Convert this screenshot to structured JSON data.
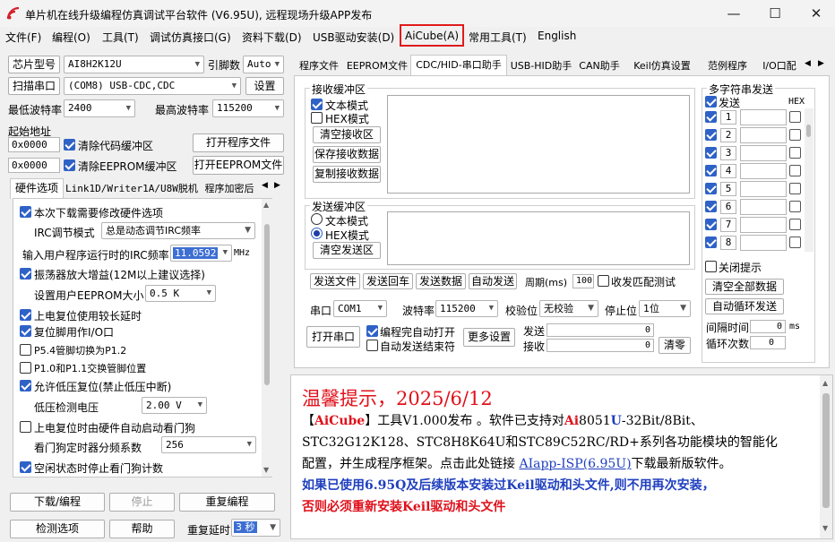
{
  "window": {
    "title": "单片机在线升级编程仿真调试平台软件 (V6.95U), 远程现场升级APP发布",
    "min": "—",
    "max": "☐",
    "close": "✕"
  },
  "menu": {
    "items": [
      "文件(F)",
      "编程(O)",
      "工具(T)",
      "调试仿真接口(G)",
      "资料下载(D)",
      "USB驱动安装(D)",
      "AiCube(A)",
      "常用工具(T)",
      "English"
    ]
  },
  "left": {
    "chip_button": "芯片型号",
    "chip_value": "AI8H2K12U",
    "pin_label": "引脚数",
    "pin_value": "Auto",
    "scan_button": "扫描串口",
    "port_value": "(COM8) USB-CDC,CDC",
    "settings_button": "设置",
    "min_baud_label": "最低波特率",
    "min_baud_value": "2400",
    "max_baud_label": "最高波特率",
    "max_baud_value": "115200",
    "start_addr_label": "起始地址",
    "addr1": "0x0000",
    "clear_code_label": "清除代码缓冲区",
    "open_prog_button": "打开程序文件",
    "addr2": "0x0000",
    "clear_eeprom_label": "清除EEPROM缓冲区",
    "open_eeprom_button": "打开EEPROM文件",
    "tabs": [
      "硬件选项",
      "Link1D/Writer1A/U8W脱机",
      "程序加密后"
    ],
    "hw": {
      "opt1": "本次下载需要修改硬件选项",
      "irc_mode_label": "IRC调节模式",
      "irc_mode_value": "总是动态调节IRC频率",
      "irc_freq_label": "输入用户程序运行时的IRC频率",
      "irc_freq_value": "11.0592",
      "irc_freq_unit": "MHz",
      "opt2": "振荡器放大增益(12M以上建议选择)",
      "eeprom_size_label": "设置用户EEPROM大小",
      "eeprom_size_value": "0.5 K",
      "opt3": "上电复位使用较长延时",
      "opt4": "复位脚用作I/O口",
      "opt5": "P5.4管脚切换为P1.2",
      "opt6": "P1.0和P1.1交换管脚位置",
      "opt7": "允许低压复位(禁止低压中断)",
      "lvd_label": "低压检测电压",
      "lvd_value": "2.00 V",
      "opt8": "上电复位时由硬件自动启动看门狗",
      "wdt_label": "看门狗定时器分频系数",
      "wdt_value": "256",
      "opt9": "空闲状态时停止看门狗计数"
    },
    "download_button": "下载/编程",
    "stop_button": "停止",
    "reprogram_button": "重复编程",
    "check_button": "检测选项",
    "help_button": "帮助",
    "repeat_delay_label": "重复延时",
    "repeat_delay_value": "3 秒"
  },
  "right": {
    "tabs": [
      "程序文件",
      "EEPROM文件",
      "CDC/HID-串口助手",
      "USB-HID助手",
      "CAN助手",
      "Keil仿真设置",
      "范例程序",
      "I/O口配"
    ],
    "recv": {
      "title": "接收缓冲区",
      "text_mode": "文本模式",
      "hex_mode": "HEX模式",
      "clear": "清空接收区",
      "save": "保存接收数据",
      "copy": "复制接收数据"
    },
    "send": {
      "title": "发送缓冲区",
      "text_mode": "文本模式",
      "hex_mode": "HEX模式",
      "clear": "清空发送区"
    },
    "send_file": "发送文件",
    "send_back": "发送回车",
    "send_data": "发送数据",
    "auto_send": "自动发送",
    "period_label": "周期(ms)",
    "period_value": "100",
    "match_label": "收发匹配测试",
    "port_label": "串口",
    "port_value": "COM1",
    "baud_label": "波特率",
    "baud_value": "115200",
    "parity_label": "校验位",
    "parity_value": "无校验",
    "stop_label": "停止位",
    "stop_value": "1位",
    "open_port": "打开串口",
    "auto_open": "编程完自动打开",
    "auto_close": "自动发送结束符",
    "more_settings": "更多设置",
    "sent_label": "发送",
    "sent_value": "0",
    "recv_label": "接收",
    "recv_value": "0",
    "zero_button": "清零",
    "multi": {
      "title": "多字符串发送",
      "send_label": "发送",
      "hex_label": "HEX",
      "rows": [
        "1",
        "2",
        "3",
        "4",
        "5",
        "6",
        "7",
        "8"
      ],
      "close_tip": "关闭提示",
      "clear_all": "清空全部数据",
      "auto_loop": "自动循环发送",
      "interval_label": "间隔时间",
      "interval_value": "0",
      "interval_unit": "ms",
      "loop_label": "循环次数",
      "loop_value": "0"
    }
  },
  "notice": {
    "heading": "温馨提示，2025/6/12",
    "l1_a": "【",
    "l1_b": "AiCube",
    "l1_c": "】工具V1.000发布 。软件已支持对",
    "l1_d": "Ai",
    "l1_e": "8051",
    "l1_f": "U",
    "l1_g": "-32Bit/8Bit、",
    "l2": "STC32G12K128、STC8H8K64U和STC89C52RC/RD+系列各功能模块的智能化",
    "l3_a": "配置，并生成程序框架。点击此处链接 ",
    "l3_link": "AIapp-ISP(6.95U)",
    "l3_b": "下载最新版软件。",
    "l4": "如果已使用6.95Q及后续版本安装过Keil驱动和头文件,则不用再次安装，",
    "l5": "否则必须重新安装Keil驱动和头文件"
  },
  "colors": {
    "accent": "#2f62c7",
    "highlight": "#e01a1a",
    "heading": "#e0101a",
    "link": "#1f3fbf"
  }
}
